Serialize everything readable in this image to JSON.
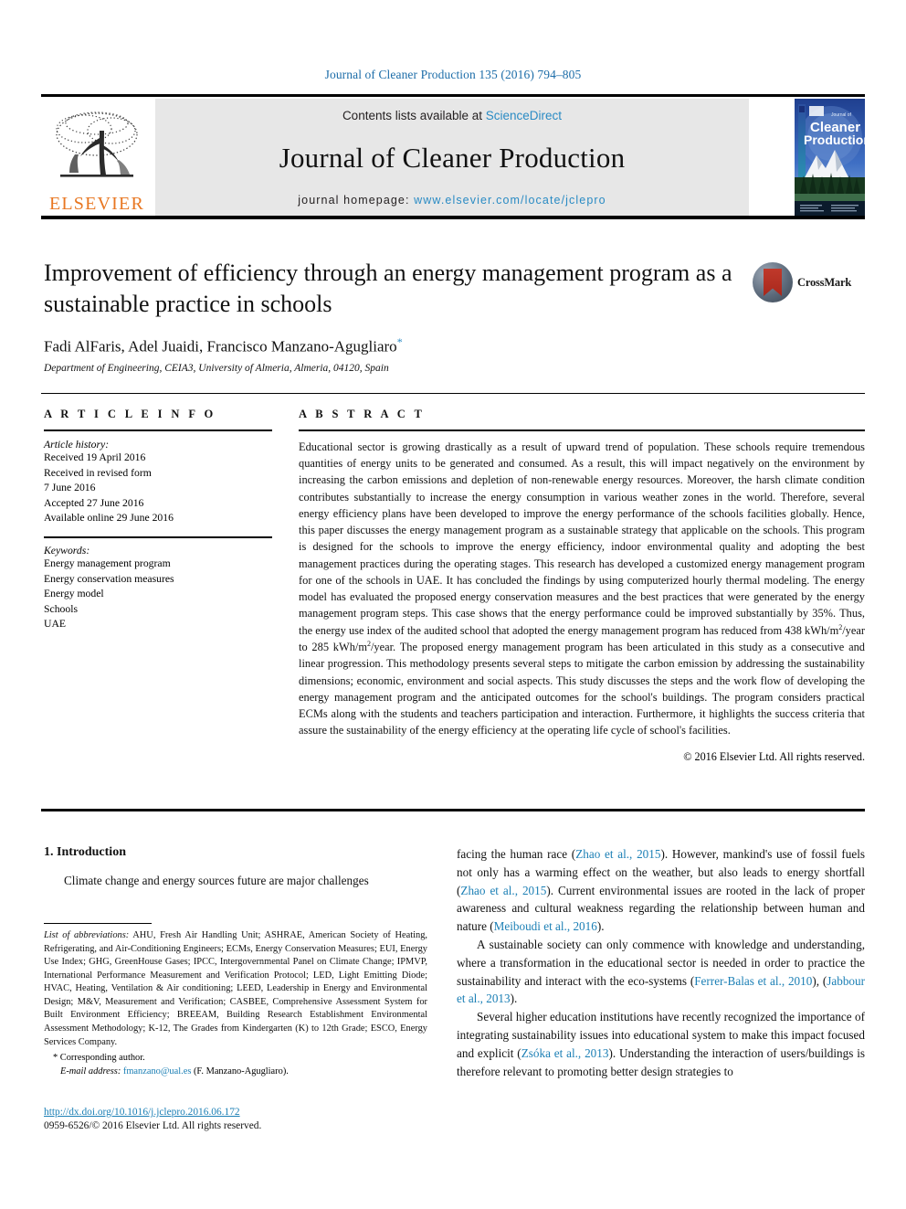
{
  "running_head": "Journal of Cleaner Production 135 (2016) 794–805",
  "masthead": {
    "contents_prefix": "Contents lists available at ",
    "sciencedirect": "ScienceDirect",
    "journal_title": "Journal of Cleaner Production",
    "homepage_label": "journal homepage: ",
    "homepage_url": "www.elsevier.com/locate/jclepro",
    "elsevier_wordmark": "ELSEVIER",
    "cover_title_small": "Journal of",
    "cover_title_line1": "Cleaner",
    "cover_title_line2": "Production"
  },
  "crossmark": {
    "label": "CrossMark"
  },
  "article": {
    "title": "Improvement of efficiency through an energy management program as a sustainable practice in schools",
    "authors": "Fadi AlFaris, Adel Juaidi, Francisco Manzano-Agugliaro",
    "corresponding_marker": "*",
    "affiliation": "Department of Engineering, CEIA3, University of Almeria, Almeria, 04120, Spain"
  },
  "article_info": {
    "heading": "A R T I C L E   I N F O",
    "history_label": "Article history:",
    "history": [
      "Received 19 April 2016",
      "Received in revised form",
      "7 June 2016",
      "Accepted 27 June 2016",
      "Available online 29 June 2016"
    ],
    "keywords_label": "Keywords:",
    "keywords": [
      "Energy management program",
      "Energy conservation measures",
      "Energy model",
      "Schools",
      "UAE"
    ]
  },
  "abstract": {
    "heading": "A B S T R A C T",
    "part1": "Educational sector is growing drastically as a result of upward trend of population. These schools require tremendous quantities of energy units to be generated and consumed. As a result, this will impact negatively on the environment by increasing the carbon emissions and depletion of non-renewable energy resources. Moreover, the harsh climate condition contributes substantially to increase the energy consumption in various weather zones in the world. Therefore, several energy efficiency plans have been developed to improve the energy performance of the schools facilities globally. Hence, this paper discusses the energy management program as a sustainable strategy that applicable on the schools. This program is designed for the schools to improve the energy efficiency, indoor environmental quality and adopting the best management practices during the operating stages. This research has developed a customized energy management program for one of the schools in UAE. It has concluded the findings by using computerized hourly thermal modeling. The energy model has evaluated the proposed energy conservation measures and the best practices that were generated by the energy management program steps. This case shows that the energy performance could be improved substantially by 35%. Thus, the energy use index of the audited school that adopted the energy management program has reduced from 438 kWh/m",
    "sup1": "2",
    "part2": "/year to 285 kWh/m",
    "sup2": "2",
    "part3": "/year. The proposed energy management program has been articulated in this study as a consecutive and linear progression. This methodology presents several steps to mitigate the carbon emission by addressing the sustainability dimensions; economic, environment and social aspects. This study discusses the steps and the work flow of developing the energy management program and the anticipated outcomes for the school's buildings. The program considers practical ECMs along with the students and teachers participation and interaction. Furthermore, it highlights the success criteria that assure the sustainability of the energy efficiency at the operating life cycle of school's facilities.",
    "copyright": "© 2016 Elsevier Ltd. All rights reserved."
  },
  "body": {
    "section1_heading": "1. Introduction",
    "left_para1": "Climate change and energy sources future are major challenges",
    "right_p1_a": "facing the human race (",
    "right_p1_ref1": "Zhao et al., 2015",
    "right_p1_b": "). However, mankind's use of fossil fuels not only has a warming effect on the weather, but also leads to energy shortfall (",
    "right_p1_ref2": "Zhao et al., 2015",
    "right_p1_c": "). Current environmental issues are rooted in the lack of proper awareness and cultural weakness regarding the relationship between human and nature (",
    "right_p1_ref3": "Meiboudi et al., 2016",
    "right_p1_d": ").",
    "right_p2_a": "A sustainable society can only commence with knowledge and understanding, where a transformation in the educational sector is needed in order to practice the sustainability and interact with the eco-systems (",
    "right_p2_ref1": "Ferrer-Balas et al., 2010",
    "right_p2_b": "), (",
    "right_p2_ref2": "Jabbour et al., 2013",
    "right_p2_c": ").",
    "right_p3_a": "Several higher education institutions have recently recognized the importance of integrating sustainability issues into educational system to make this impact focused and explicit (",
    "right_p3_ref1": "Zsóka et al., 2013",
    "right_p3_b": "). Understanding the interaction of users/buildings is therefore relevant to promoting better design strategies to"
  },
  "footnote": {
    "abbrev_label": "List of abbreviations:",
    "abbrev_text": " AHU, Fresh Air Handling Unit; ASHRAE, American Society of Heating, Refrigerating, and Air-Conditioning Engineers; ECMs, Energy Conservation Measures; EUI, Energy Use Index; GHG, GreenHouse Gases; IPCC, Intergovernmental Panel on Climate Change; IPMVP, International Performance Measurement and Verification Protocol; LED, Light Emitting Diode; HVAC, Heating, Ventilation & Air conditioning; LEED, Leadership in Energy and Environmental Design; M&V, Measurement and Verification; CASBEE, Comprehensive Assessment System for Built Environment Efficiency; BREEAM, Building Research Establishment Environmental Assessment Methodology; K-12, The Grades from Kindergarten (K) to 12th Grade; ESCO, Energy Services Company.",
    "corresponding": "* Corresponding author.",
    "email_label": "E-mail address:",
    "email": "fmanzano@ual.es",
    "email_suffix": " (F. Manzano-Agugliaro).",
    "doi": "http://dx.doi.org/10.1016/j.jclepro.2016.06.172",
    "issn": "0959-6526/© 2016 Elsevier Ltd. All rights reserved."
  },
  "colors": {
    "link_blue": "#1b7fb5",
    "elsevier_orange": "#e87722",
    "masthead_gray": "#e7e7e7"
  }
}
